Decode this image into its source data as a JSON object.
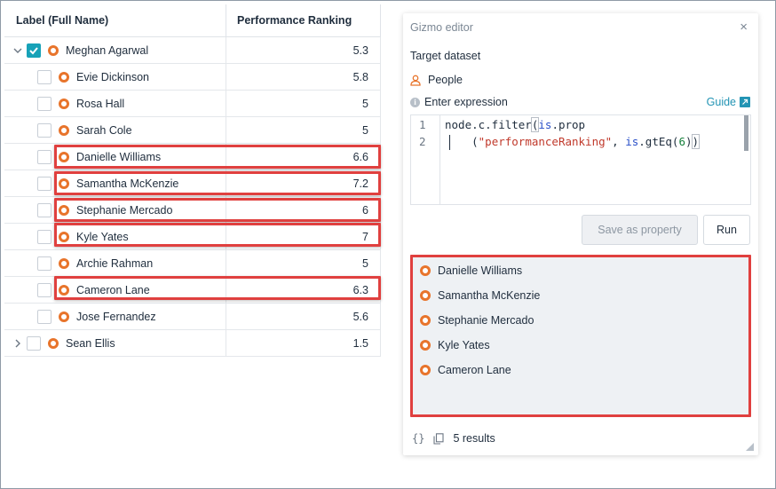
{
  "table": {
    "col_label": "Label (Full Name)",
    "col_rank": "Performance Ranking",
    "root": {
      "name": "Meghan Agarwal",
      "rank": "5.3",
      "checked": true,
      "expanded": true
    },
    "children": [
      {
        "name": "Evie Dickinson",
        "rank": "5.8",
        "highlighted": false
      },
      {
        "name": "Rosa Hall",
        "rank": "5",
        "highlighted": false
      },
      {
        "name": "Sarah Cole",
        "rank": "5",
        "highlighted": false
      },
      {
        "name": "Danielle Williams",
        "rank": "6.6",
        "highlighted": true
      },
      {
        "name": "Samantha McKenzie",
        "rank": "7.2",
        "highlighted": true
      },
      {
        "name": "Stephanie Mercado",
        "rank": "6",
        "highlighted": true
      },
      {
        "name": "Kyle Yates",
        "rank": "7",
        "highlighted": true
      },
      {
        "name": "Archie Rahman",
        "rank": "5",
        "highlighted": false
      },
      {
        "name": "Cameron Lane",
        "rank": "6.3",
        "highlighted": true
      },
      {
        "name": "Jose Fernandez",
        "rank": "5.6",
        "highlighted": false
      }
    ],
    "sibling": {
      "name": "Sean Ellis",
      "rank": "1.5",
      "expanded": false
    }
  },
  "gizmo": {
    "title": "Gizmo editor",
    "close": "×",
    "target_label": "Target dataset",
    "dataset_name": "People",
    "expression_label": "Enter expression",
    "guide_label": "Guide",
    "line1_no": "1",
    "line2_no": "2",
    "code_line1_a": "node.c.filter",
    "code_line1_paren": "(",
    "code_line1_kw": "is",
    "code_line1_b": ".prop",
    "code_line2_indent": "    (",
    "code_line2_str": "\"performanceRanking\"",
    "code_line2_mid": ", ",
    "code_line2_kw": "is",
    "code_line2_fn": ".gtEq(",
    "code_line2_num": "6",
    "code_line2_end": ")",
    "code_line2_last": ")",
    "save_label": "Save as property",
    "run_label": "Run",
    "results": [
      "Danielle Williams",
      "Samantha McKenzie",
      "Stephanie Mercado",
      "Kyle Yates",
      "Cameron Lane"
    ],
    "results_count": "5 results"
  },
  "colors": {
    "accent": "#17a2b8",
    "node": "#e8742b",
    "highlight": "#e0403f",
    "link": "#2394b4"
  }
}
